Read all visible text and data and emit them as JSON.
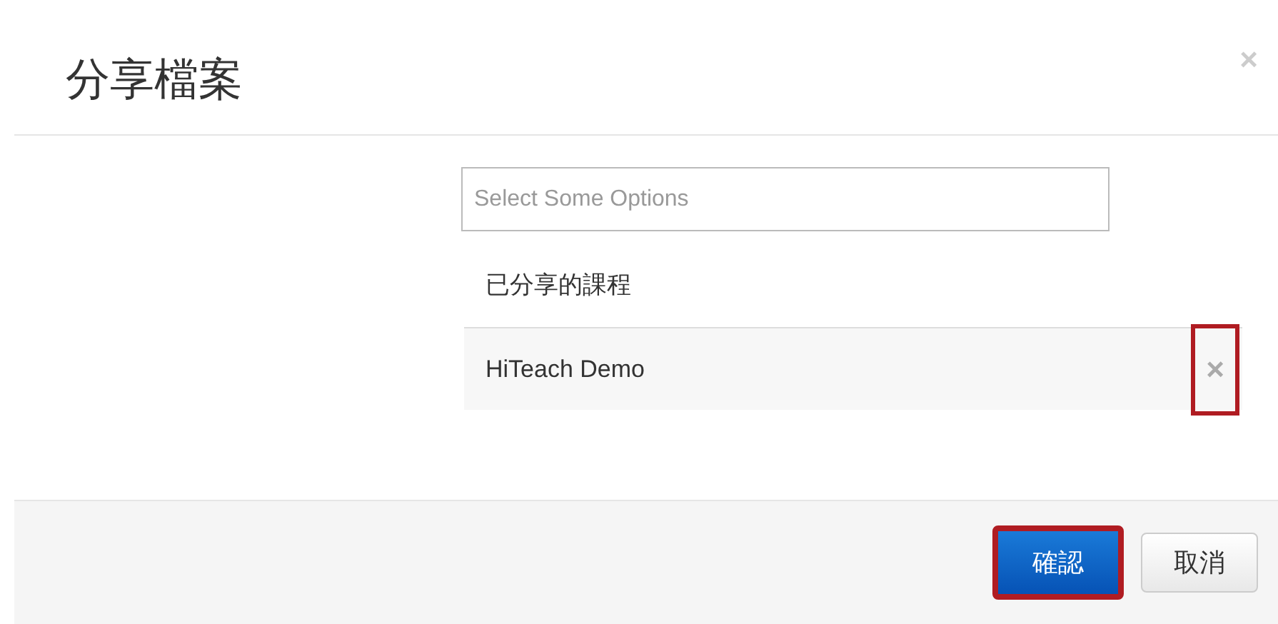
{
  "dialog": {
    "title": "分享檔案",
    "close": "×"
  },
  "select": {
    "placeholder": "Select Some Options"
  },
  "shared_heading": "已分享的課程",
  "shared_courses": [
    {
      "name": "HiTeach Demo",
      "remove": "×",
      "highlighted": true
    }
  ],
  "buttons": [
    {
      "label": "確認",
      "kind": "primary",
      "highlighted": true
    },
    {
      "label": "取消",
      "kind": "default",
      "highlighted": false
    }
  ]
}
